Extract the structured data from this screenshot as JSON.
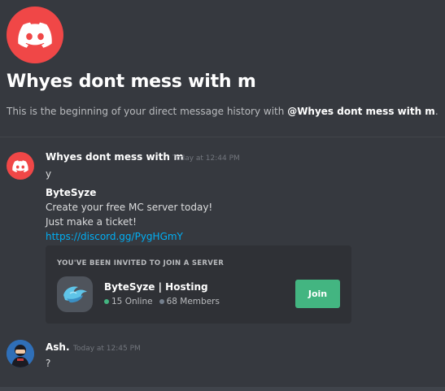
{
  "header": {
    "avatar_icon": "discord-logo-icon",
    "title": "Whyes dont mess with m",
    "subtitle_prefix": "This is the beginning of your direct message history with ",
    "subtitle_name": "@Whyes dont mess with m",
    "subtitle_suffix": "."
  },
  "messages": [
    {
      "author": "Whyes dont mess with m",
      "timestamp": "Today at 12:44 PM",
      "avatar_icon": "discord-logo-icon",
      "lines": [
        "y"
      ]
    },
    {
      "author": "Ash.",
      "timestamp": "Today at 12:45 PM",
      "avatar_icon": "user-avatar-icon",
      "lines": [
        "?"
      ]
    }
  ],
  "embed": {
    "title": "ByteSyze",
    "line1": "Create your free MC server today!",
    "line2": "Just make a ticket!",
    "link": "https://discord.gg/PygHGmY"
  },
  "invite": {
    "heading": "YOU'VE BEEN INVITED TO JOIN A SERVER",
    "server_name": "ByteSyze | Hosting",
    "online": "15 Online",
    "members": "68 Members",
    "join_label": "Join",
    "server_icon": "bytesyze-logo-icon"
  },
  "colors": {
    "background": "#36393f",
    "accent_red": "#f04747",
    "join_green": "#43b581",
    "link_blue": "#00aff4"
  }
}
